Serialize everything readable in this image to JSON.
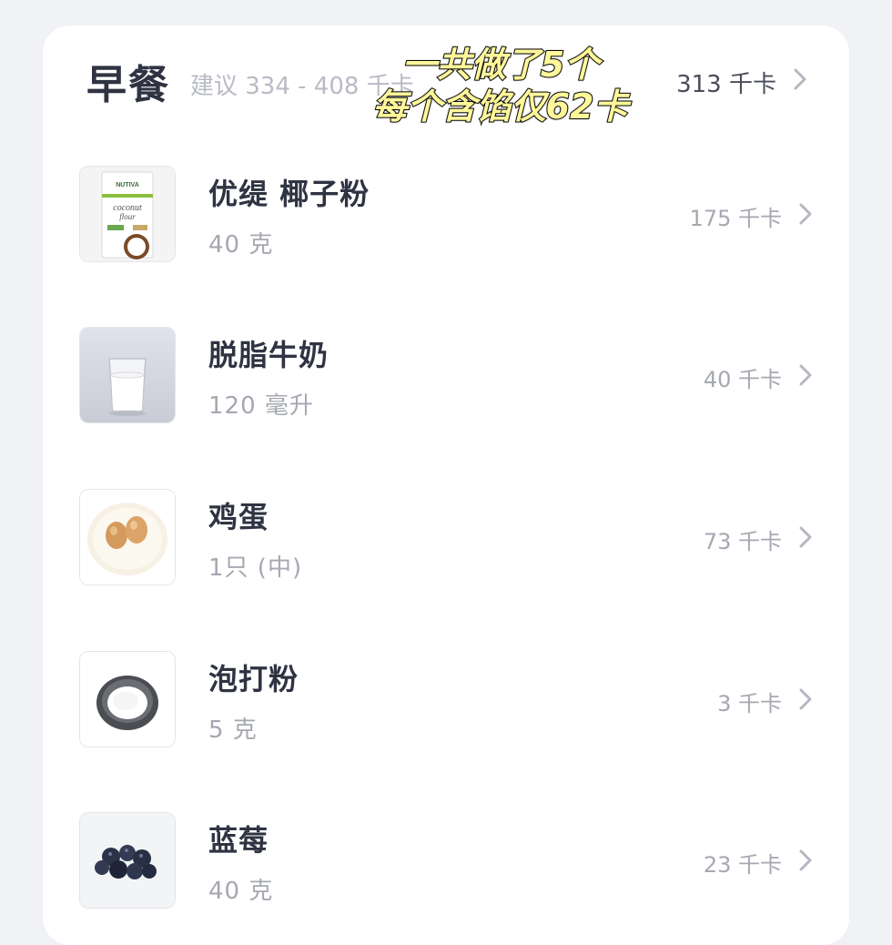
{
  "meal": {
    "title": "早餐",
    "suggestion": "建议 334 - 408 千卡",
    "total": "313 千卡"
  },
  "overlay": {
    "line1": "一共做了5个",
    "line2": "每个含馅仅62卡"
  },
  "foods": [
    {
      "name": "优缇 椰子粉",
      "amount": "40 克",
      "kcal": "175 千卡",
      "icon": "coconut-flour-bag-icon"
    },
    {
      "name": "脱脂牛奶",
      "amount": "120 毫升",
      "kcal": "40 千卡",
      "icon": "milk-glass-icon"
    },
    {
      "name": "鸡蛋",
      "amount": "1只 (中)",
      "kcal": "73 千卡",
      "icon": "eggs-plate-icon"
    },
    {
      "name": "泡打粉",
      "amount": "5 克",
      "kcal": "3 千卡",
      "icon": "baking-powder-bowl-icon"
    },
    {
      "name": "蓝莓",
      "amount": "40 克",
      "kcal": "23 千卡",
      "icon": "blueberries-icon"
    }
  ],
  "thumb_text": {
    "brand": "NUTIVA",
    "coconut": "coconut",
    "flour": "flour"
  },
  "colors": {
    "background": "#f0f2f6",
    "card": "#ffffff",
    "title": "#2f3342",
    "muted": "#a5a8b1",
    "overlay_text": "#fff79a"
  }
}
